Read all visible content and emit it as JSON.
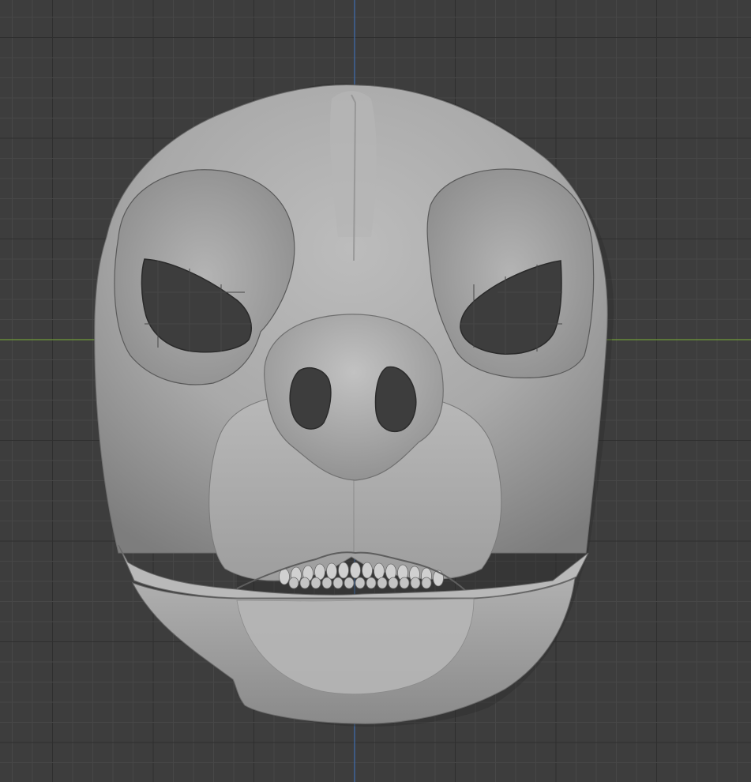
{
  "viewport": {
    "view": "front-orthographic",
    "object": "pig-mask-sculpt",
    "shading": "solid",
    "background_color": "#3d3d3d",
    "grid_minor_color": "#474747",
    "grid_major_color": "#2f2f2f",
    "axis_x_color": "#6f9a3a",
    "axis_z_color": "#3f6fb0",
    "mesh_color": "#a8a8a8"
  }
}
